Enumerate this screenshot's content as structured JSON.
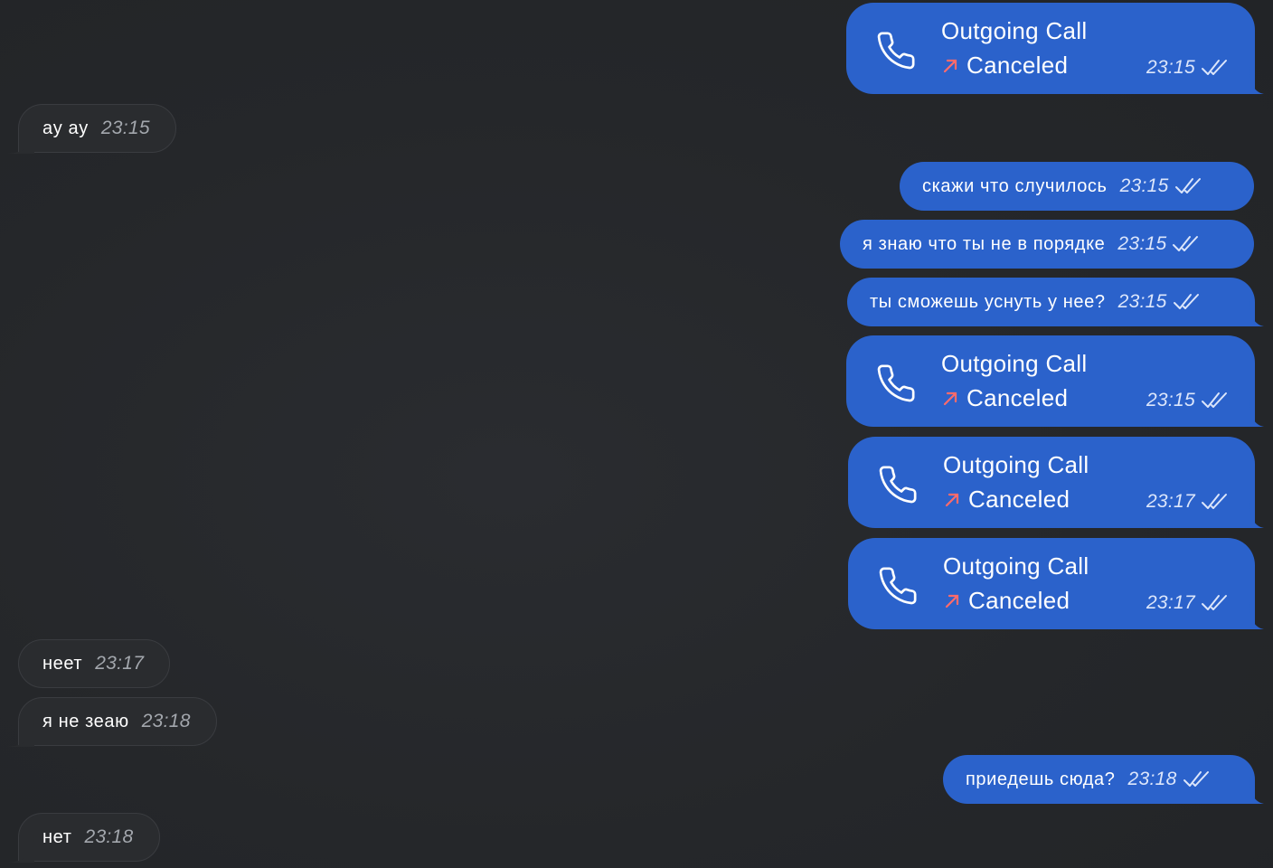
{
  "colors": {
    "outgoing_bubble": "#2b62cb",
    "incoming_bubble": "#2a2c2f",
    "background": "#25272a",
    "canceled_arrow": "#ff6b6b"
  },
  "messages": [
    {
      "type": "call",
      "title": "Outgoing Call",
      "status": "Canceled",
      "time": "23:15"
    },
    {
      "type": "text_in",
      "text": "ay ay",
      "time": "23:15"
    },
    {
      "type": "text_out",
      "text": "скажи что случилось",
      "time": "23:15"
    },
    {
      "type": "text_out",
      "text": "я знаю что ты не в порядке",
      "time": "23:15"
    },
    {
      "type": "text_out",
      "text": "ты сможешь уснуть у нее?",
      "time": "23:15"
    },
    {
      "type": "call",
      "title": "Outgoing Call",
      "status": "Canceled",
      "time": "23:15"
    },
    {
      "type": "call",
      "title": "Outgoing Call",
      "status": "Canceled",
      "time": "23:17"
    },
    {
      "type": "call",
      "title": "Outgoing Call",
      "status": "Canceled",
      "time": "23:17"
    },
    {
      "type": "text_in",
      "text": "неет",
      "time": "23:17"
    },
    {
      "type": "text_in",
      "text": "я не зеаю",
      "time": "23:18"
    },
    {
      "type": "text_out",
      "text": "приедешь сюда?",
      "time": "23:18"
    },
    {
      "type": "text_in",
      "text": "нет",
      "time": "23:18"
    }
  ]
}
